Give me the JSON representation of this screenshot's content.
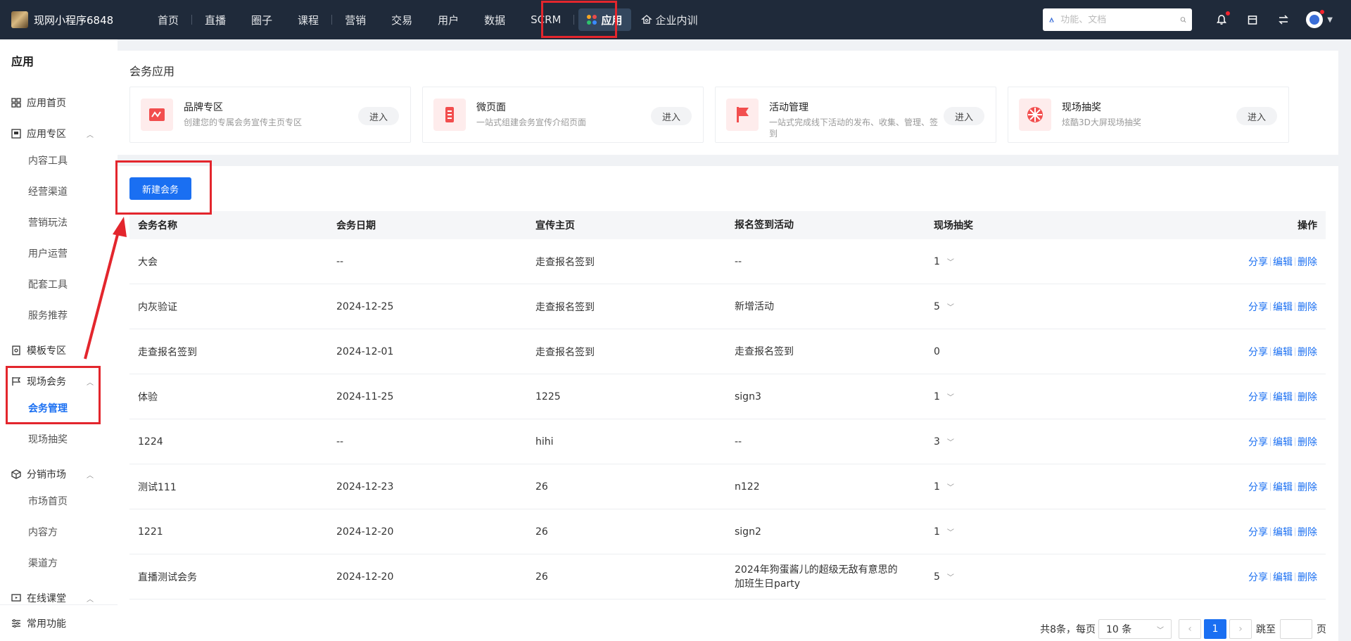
{
  "brand": {
    "title": "现网小程序6848"
  },
  "nav": {
    "items": [
      "首页",
      "直播",
      "圈子",
      "课程",
      "营销",
      "交易",
      "用户",
      "数据",
      "SCRM"
    ],
    "active": "应用",
    "extra": "企业内训"
  },
  "search": {
    "placeholder": "功能、文档"
  },
  "sidebar": {
    "title": "应用",
    "app_home": "应用首页",
    "app_zone": "应用专区",
    "app_zone_items": [
      "内容工具",
      "经营渠道",
      "营销玩法",
      "用户运营",
      "配套工具",
      "服务推荐"
    ],
    "template_zone": "模板专区",
    "live_meeting": "现场会务",
    "live_meeting_items": [
      "会务管理",
      "现场抽奖"
    ],
    "distribution": "分销市场",
    "distribution_items": [
      "市场首页",
      "内容方",
      "渠道方"
    ],
    "online_class": "在线课堂",
    "common": "常用功能"
  },
  "apps": {
    "title": "会务应用",
    "enter_label": "进入",
    "cards": [
      {
        "name": "品牌专区",
        "desc": "创建您的专属会务宣传主页专区",
        "icon": "brand-zone-icon"
      },
      {
        "name": "微页面",
        "desc": "一站式组建会务宣传介绍页面",
        "icon": "micro-page-icon"
      },
      {
        "name": "活动管理",
        "desc": "一站式完成线下活动的发布、收集、管理、签到",
        "icon": "flag-icon"
      },
      {
        "name": "现场抽奖",
        "desc": "炫酷3D大屏现场抽奖",
        "icon": "lottery-wheel-icon"
      }
    ]
  },
  "list": {
    "new_button": "新建会务",
    "columns": [
      "会务名称",
      "会务日期",
      "宣传主页",
      "报名签到活动",
      "现场抽奖",
      "操作"
    ],
    "actions": [
      "分享",
      "编辑",
      "删除"
    ],
    "rows": [
      {
        "name": "大会",
        "date": "--",
        "home": "走查报名签到",
        "activity": "--",
        "lottery": "1",
        "dropdown": true
      },
      {
        "name": "内灰验证",
        "date": "2024-12-25",
        "home": "走查报名签到",
        "activity": "新增活动",
        "lottery": "5",
        "dropdown": true
      },
      {
        "name": "走查报名签到",
        "date": "2024-12-01",
        "home": "走查报名签到",
        "activity": "走查报名签到",
        "lottery": "0",
        "dropdown": false
      },
      {
        "name": "体验",
        "date": "2024-11-25",
        "home": "1225",
        "activity": "sign3",
        "lottery": "1",
        "dropdown": true
      },
      {
        "name": "1224",
        "date": "--",
        "home": "hihi",
        "activity": "--",
        "lottery": "3",
        "dropdown": true
      },
      {
        "name": "测试111",
        "date": "2024-12-23",
        "home": "26",
        "activity": "n122",
        "lottery": "1",
        "dropdown": true
      },
      {
        "name": "1221",
        "date": "2024-12-20",
        "home": "26",
        "activity": "sign2",
        "lottery": "1",
        "dropdown": true
      },
      {
        "name": "直播测试会务",
        "date": "2024-12-20",
        "home": "26",
        "activity": "2024年狗蛋酱儿的超级无敌有意思的加班生日party",
        "lottery": "5",
        "dropdown": true
      }
    ]
  },
  "pager": {
    "total_text": "共8条，每页",
    "page_size": "10 条",
    "current_page": "1",
    "jump_label": "跳至",
    "page_unit": "页"
  },
  "colors": {
    "primary": "#1a6ff2",
    "topbar": "#1f2a3a",
    "highlight": "#e3262d"
  }
}
